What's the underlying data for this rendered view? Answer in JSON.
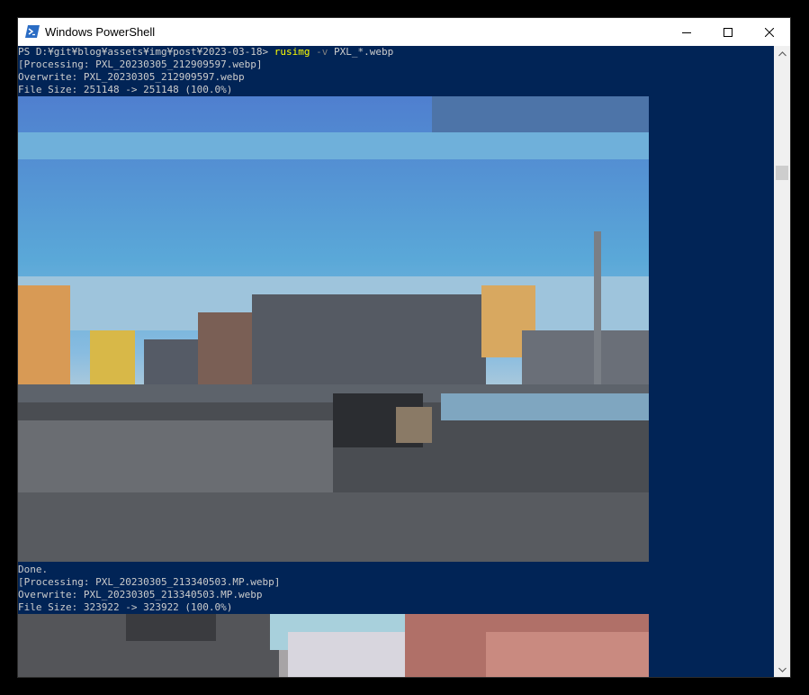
{
  "window": {
    "title": "Windows PowerShell",
    "icon": "powershell-icon",
    "background": "#012456"
  },
  "titlebar_buttons": {
    "minimize": "minimize-icon",
    "maximize": "maximize-icon",
    "close": "close-icon"
  },
  "console": {
    "prompt": "PS D:¥git¥blog¥assets¥img¥post¥2023-03-18>",
    "command": "rusimg",
    "flag": "-v",
    "argument": "PXL_*.webp",
    "block1": {
      "processing": "[Processing: PXL_20230305_212909597.webp]",
      "overwrite": "Overwrite: PXL_20230305_212909597.webp",
      "filesize": "File Size: 251148 -> 251148 (100.0%)"
    },
    "done": "Done.",
    "block2": {
      "processing": "[Processing: PXL_20230305_213340503.MP.webp]",
      "overwrite": "Overwrite: PXL_20230305_213340503.MP.webp",
      "filesize": "File Size: 323922 -> 323922 (100.0%)"
    }
  },
  "images": [
    {
      "name": "pixelated-photo-street-scene",
      "description": "preview"
    },
    {
      "name": "pixelated-photo-building",
      "description": "preview"
    }
  ],
  "scrollbar": {
    "up": "scroll-up-arrow-icon",
    "down": "scroll-down-arrow-icon"
  }
}
